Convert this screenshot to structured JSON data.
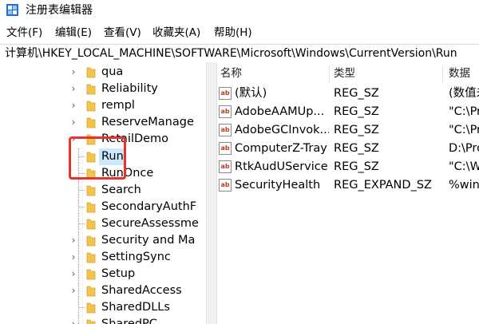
{
  "window": {
    "title": "注册表编辑器"
  },
  "menu": [
    {
      "label": "文件(F)"
    },
    {
      "label": "编辑(E)"
    },
    {
      "label": "查看(V)"
    },
    {
      "label": "收藏夹(A)"
    },
    {
      "label": "帮助(H)"
    }
  ],
  "address": {
    "path": "计算机\\HKEY_LOCAL_MACHINE\\SOFTWARE\\Microsoft\\Windows\\CurrentVersion\\Run"
  },
  "tree": {
    "items": [
      {
        "label": "qua",
        "expandable": true
      },
      {
        "label": "Reliability",
        "expandable": true
      },
      {
        "label": "rempl",
        "expandable": true
      },
      {
        "label": "ReserveManage",
        "expandable": true
      },
      {
        "label": "RetailDemo",
        "expandable": true
      },
      {
        "label": "Run",
        "expandable": false,
        "selected": true
      },
      {
        "label": "RunOnce",
        "expandable": false
      },
      {
        "label": "Search",
        "expandable": false
      },
      {
        "label": "SecondaryAuthF",
        "expandable": false
      },
      {
        "label": "SecureAssessme",
        "expandable": false
      },
      {
        "label": "Security and Ma",
        "expandable": true
      },
      {
        "label": "SettingSync",
        "expandable": true
      },
      {
        "label": "Setup",
        "expandable": true
      },
      {
        "label": "SharedAccess",
        "expandable": true
      },
      {
        "label": "SharedDLLs",
        "expandable": false
      },
      {
        "label": "SharedPC",
        "expandable": true
      }
    ]
  },
  "list": {
    "columns": {
      "name": "名称",
      "type": "类型",
      "data": "数据"
    },
    "rows": [
      {
        "name": "(默认)",
        "type": "REG_SZ",
        "data": "(数值未"
      },
      {
        "name": "AdobeAAMUp...",
        "type": "REG_SZ",
        "data": "\"C:\\Pr"
      },
      {
        "name": "AdobeGCInvok...",
        "type": "REG_SZ",
        "data": "\"C:\\Pr"
      },
      {
        "name": "ComputerZ-Tray",
        "type": "REG_SZ",
        "data": "D:\\Pro"
      },
      {
        "name": "RtkAudUService",
        "type": "REG_SZ",
        "data": "\"C:\\W"
      },
      {
        "name": "SecurityHealth",
        "type": "REG_EXPAND_SZ",
        "data": "%win"
      }
    ]
  },
  "icons": {
    "app": "registry-editor-icon",
    "folder": "folder-icon",
    "value": "string-value-icon",
    "expander": "chevron-right-icon"
  },
  "colors": {
    "selection": "#cce8ff",
    "highlight_box": "#e8332d",
    "folder": "#f2c44e"
  }
}
